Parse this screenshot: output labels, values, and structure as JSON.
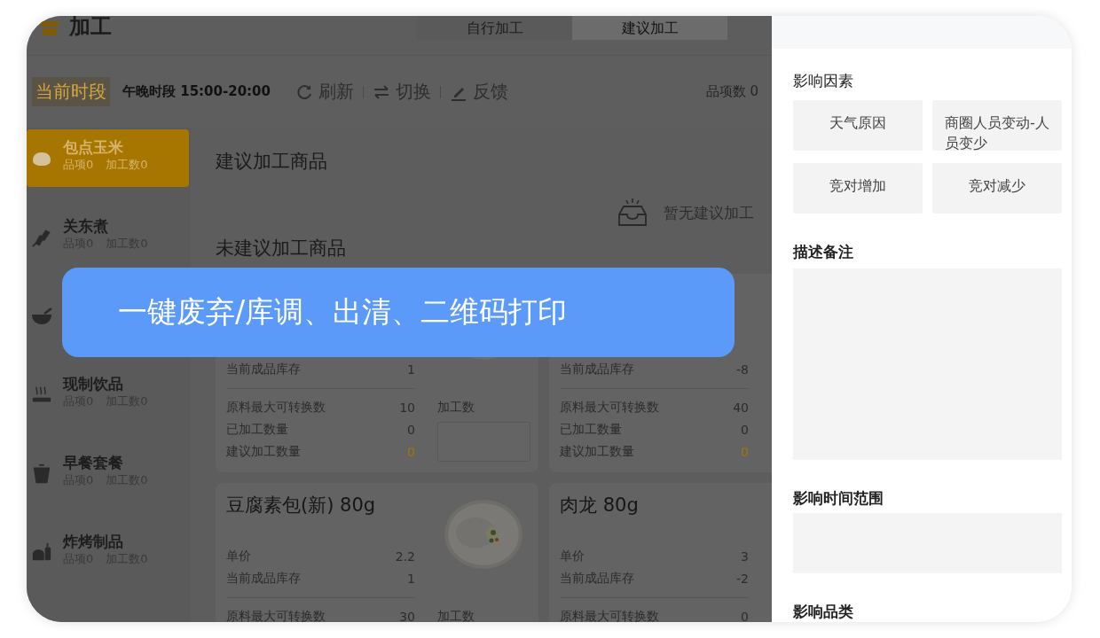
{
  "app_header": {
    "title": "加工",
    "tabs": [
      {
        "label": "自行加工",
        "selected": false
      },
      {
        "label": "建议加工",
        "selected": true
      }
    ]
  },
  "toolbar": {
    "period_label": "当前时段",
    "period": "午晚时段 15:00-20:00",
    "actions": [
      {
        "kind": "refresh",
        "label": "刷新"
      },
      {
        "kind": "switch",
        "label": "切换"
      },
      {
        "kind": "edit",
        "label": "反馈"
      }
    ],
    "item_count": "品项数 0"
  },
  "sidebar": {
    "items": [
      {
        "kind": "bun",
        "name": "包点玉米",
        "stats": [
          "品项0",
          "加工数0"
        ],
        "selected": true
      },
      {
        "kind": "skewer",
        "name": "关东煮",
        "stats": [
          "品项0",
          "加工数0"
        ],
        "selected": false
      },
      {
        "kind": "bowl",
        "selected": false
      },
      {
        "kind": "steam",
        "name": "现制饮品",
        "stats": [
          "品项0",
          "加工数0"
        ],
        "selected": false
      },
      {
        "kind": "cup",
        "name": "早餐套餐",
        "stats": [
          "品项0",
          "加工数0"
        ],
        "selected": false
      },
      {
        "kind": "fryer",
        "name": "炸烤制品",
        "stats": [
          "品项0",
          "加工数0"
        ],
        "selected": false
      }
    ]
  },
  "suggested": {
    "title": "建议加工商品",
    "empty_text": "暂无建议加工"
  },
  "unsuggested": {
    "title": "未建议加工商品",
    "cards": [
      {
        "image": {
          "kind": "picture"
        },
        "upper_rows": [
          {
            "label": "当前成品库存",
            "value": "1"
          }
        ],
        "lower_rows": [
          {
            "label": "原料最大可转换数",
            "value": "10",
            "kind": "plain"
          },
          {
            "label": "已加工数量",
            "value": "0",
            "kind": "plain"
          },
          {
            "label": "建议加工数量",
            "value": "0",
            "kind": "highlight"
          }
        ],
        "qty_label": "加工数"
      },
      {
        "upper_rows": [
          {
            "label": "当前成品库存",
            "value": "-8"
          }
        ],
        "lower_rows": [
          {
            "label": "原料最大可转换数",
            "value": "40",
            "kind": "plain"
          },
          {
            "label": "已加工数量",
            "value": "0",
            "kind": "plain"
          },
          {
            "label": "建议加工数量",
            "value": "0",
            "kind": "highlight"
          }
        ]
      },
      {
        "name": "豆腐素包(新) 80g",
        "image": {
          "kind": "picture"
        },
        "upper_rows": [
          {
            "label": "单价",
            "value": "2.2"
          },
          {
            "label": "当前成品库存",
            "value": "1"
          }
        ],
        "lower_rows": [
          {
            "label": "原料最大可转换数",
            "value": "30",
            "kind": "plain"
          }
        ],
        "qty_label": "加工数"
      },
      {
        "name": "肉龙 80g",
        "upper_rows": [
          {
            "label": "单价",
            "value": "3"
          },
          {
            "label": "当前成品库存",
            "value": "-2"
          }
        ],
        "lower_rows": [
          {
            "label": "原料最大可转换数",
            "value": "0",
            "kind": "plain"
          }
        ]
      }
    ]
  },
  "banner": {
    "text": "一键废弃/库调、出清、二维码打印"
  },
  "panel": {
    "sections": [
      {
        "kind": "options",
        "label": "影响因素",
        "options": [
          "天气原因",
          "商圈人员变动-人员变少",
          "竞对增加",
          "竞对减少"
        ]
      },
      {
        "kind": "textarea",
        "label": "描述备注"
      },
      {
        "kind": "field",
        "label": "影响时间范围"
      },
      {
        "kind": "label",
        "label": "影响品类"
      }
    ]
  }
}
